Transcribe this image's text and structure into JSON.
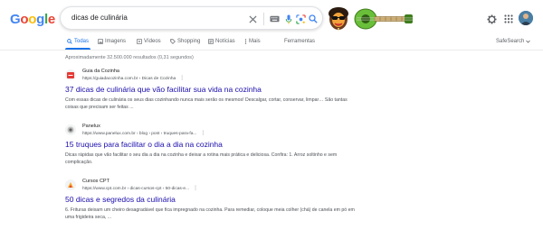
{
  "logo": {
    "letters": [
      {
        "ch": "G",
        "color": "#4285f4"
      },
      {
        "ch": "o",
        "color": "#ea4335"
      },
      {
        "ch": "o",
        "color": "#fbbc05"
      },
      {
        "ch": "g",
        "color": "#4285f4"
      },
      {
        "ch": "l",
        "color": "#34a853"
      },
      {
        "ch": "e",
        "color": "#ea4335"
      }
    ]
  },
  "search": {
    "query": "dicas de culinária",
    "icons": [
      "clear-icon",
      "keyboard-icon",
      "microphone-icon",
      "lens-icon",
      "search-icon"
    ]
  },
  "header": {
    "right_icons": [
      "settings-icon",
      "apps-icon"
    ],
    "doodle": "guitar-doodle"
  },
  "tabs": {
    "items": [
      {
        "label": "Todas",
        "icon": "search-icon",
        "active": true
      },
      {
        "label": "Imagens",
        "icon": "image-icon",
        "active": false
      },
      {
        "label": "Vídeos",
        "icon": "video-icon",
        "active": false
      },
      {
        "label": "Shopping",
        "icon": "tag-icon",
        "active": false
      },
      {
        "label": "Notícias",
        "icon": "news-icon",
        "active": false
      },
      {
        "label": "Mais",
        "icon": "more-icon",
        "active": false
      }
    ],
    "tools": "Ferramentas",
    "safesearch": "SafeSearch"
  },
  "stats": "Aproximadamente 32.500.000 resultados (0,31 segundos)",
  "results": [
    {
      "site_name": "Guia da Cozinha",
      "url": "https://guiadacozinha.com.br › Dicas de Cozinha",
      "title": "37 dicas de culinária que vão facilitar sua vida na cozinha",
      "snippet": "Com essas dicas de culinária os seus dias cozinhando nunca mais serão os mesmos! Descalgar, cortar, conservar, limpar… São tantas coisas que precisam ser feitas ...",
      "favicon_color": "#e53935"
    },
    {
      "site_name": "Panelux",
      "url": "https://www.panelux.com.br › blog › post › truques-para-fa...",
      "title": "15 truques para facilitar o dia a dia na cozinha",
      "snippet": "Dicas rápidas que vão facilitar o seu dia a dia na cozinha e deixar a rotina mais prática e deliciosa. Confira: 1. Arroz soltinho e sem complicação.",
      "favicon_color": "#9e9e9e"
    },
    {
      "site_name": "Cursos CPT",
      "url": "https://www.cpt.com.br › dicas-cursos-cpt › 50-dicas-e...",
      "title": "50 dicas e segredos da culinária",
      "snippet": "6. Frituras deixam um cheiro desagradável que fica impregnado na cozinha. Para remediar, coloque meia colher (chá) de canela em pó em uma frigideira seca, ...",
      "favicon_color": "#f9a825"
    }
  ]
}
